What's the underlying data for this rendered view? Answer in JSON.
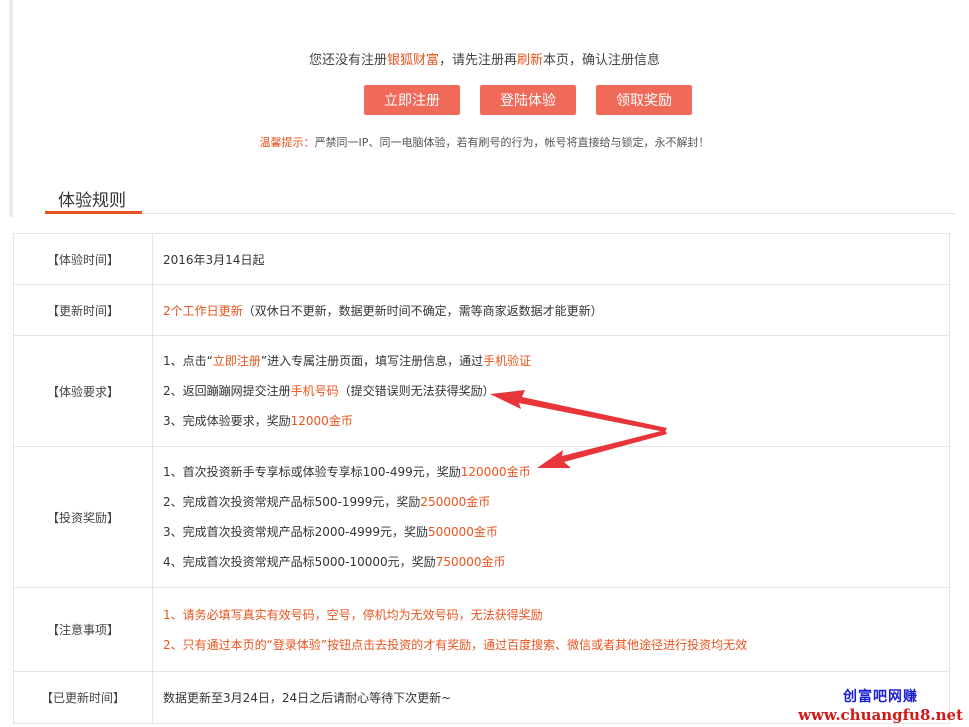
{
  "notice": {
    "prefix": "您还没有注册",
    "brand": "银狐财富",
    "mid": "，请先注册再",
    "refresh": "刷新",
    "suffix": "本页，确认注册信息"
  },
  "buttons": {
    "register": "立即注册",
    "login": "登陆体验",
    "claim": "领取奖励"
  },
  "warning": {
    "label": "温馨提示：",
    "text": "严禁同一IP、同一电脑体验，若有刷号的行为，帐号将直接给与锁定，永不解封！"
  },
  "rules": {
    "title": "体验规则",
    "time": {
      "label": "【体验时间】",
      "value": "2016年3月14日起"
    },
    "update": {
      "label": "【更新时间】",
      "hl": "2个工作日更新",
      "rest": "（双休日不更新，数据更新时间不确定，需等商家返数据才能更新）"
    },
    "req": {
      "label": "【体验要求】",
      "l1a": "1、点击“",
      "l1b": "立即注册",
      "l1c": "”进入专属注册页面，填写注册信息，通过",
      "l1d": "手机验证",
      "l2a": "2、返回蹦蹦网提交注册",
      "l2b": "手机号码",
      "l2c": "（提交错误则无法获得奖励）",
      "l3a": "3、完成体验要求，奖励",
      "l3b": "12000金币"
    },
    "invest": {
      "label": "【投资奖励】",
      "l1a": "1、首次投资新手专享标或体验专享标100-499元，奖励",
      "l1b": "120000金币",
      "l2a": "2、完成首次投资常规产品标500-1999元，奖励",
      "l2b": "250000金币",
      "l3a": "3、完成首次投资常规产品标2000-4999元，奖励",
      "l3b": "500000金币",
      "l4a": "4、完成首次投资常规产品标5000-10000元，奖励",
      "l4b": "750000金币"
    },
    "notes": {
      "label": "【注意事项】",
      "l1": "1、请务必填写真实有效号码，空号，停机均为无效号码，无法获得奖励",
      "l2": "2、只有通过本页的“登录体验”按钮点击去投资的才有奖励，通过百度搜索、微信或者其他途径进行投资均无效"
    },
    "updated": {
      "label": "【已更新时间】",
      "value": "数据更新至3月24日，24日之后请耐心等待下次更新~"
    }
  },
  "watermark": {
    "line1": "创富吧网赚",
    "line2": "www.chuangfu8.net"
  },
  "colors": {
    "accent": "#e8541e",
    "button": "#f06a5a",
    "arrow": "#e8353a"
  }
}
